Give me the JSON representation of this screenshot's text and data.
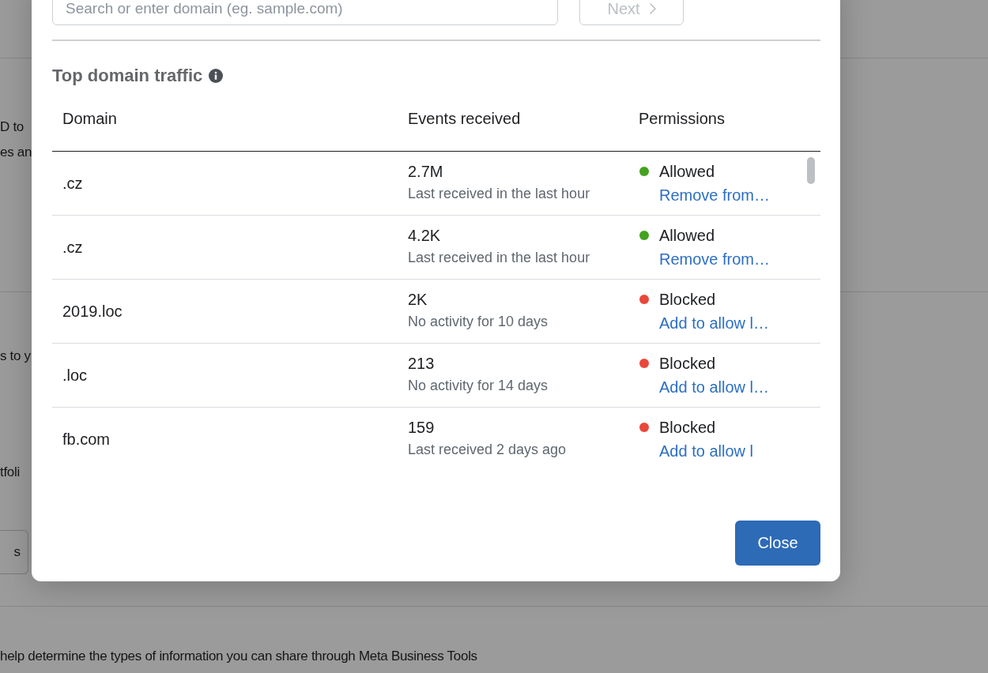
{
  "background_page": {
    "intro_lines": [
      "D to",
      "es an"
    ],
    "settings_lines": [
      "s to y",
      "tfoli"
    ],
    "settings_button": "s",
    "footer_text": "help determine the types of information you can share through Meta Business Tools"
  },
  "dialog": {
    "search": {
      "placeholder": "Search or enter domain (eg. sample.com)"
    },
    "next_button": {
      "label": "Next",
      "disabled": true
    },
    "section_title": "Top domain traffic",
    "table": {
      "columns": [
        "Domain",
        "Events received",
        "Permissions"
      ],
      "rows": [
        {
          "domain": ".cz",
          "events": "2.7M",
          "last_activity": "Last received in the last hour",
          "permission": {
            "status": "Allowed",
            "color": "#45a21d",
            "action": "Remove from…"
          }
        },
        {
          "domain": ".cz",
          "events": "4.2K",
          "last_activity": "Last received in the last hour",
          "permission": {
            "status": "Allowed",
            "color": "#45a21d",
            "action": "Remove from…"
          }
        },
        {
          "domain": "2019.loc",
          "events": "2K",
          "last_activity": "No activity for 10 days",
          "permission": {
            "status": "Blocked",
            "color": "#e9473b",
            "action": "Add to allow l…"
          }
        },
        {
          "domain": ".loc",
          "events": "213",
          "last_activity": "No activity for 14 days",
          "permission": {
            "status": "Blocked",
            "color": "#e9473b",
            "action": "Add to allow l…"
          }
        },
        {
          "domain": "fb.com",
          "events": "159",
          "last_activity": "Last received 2 days ago",
          "permission": {
            "status": "Blocked",
            "color": "#e9473b",
            "action": "Add to allow l"
          }
        }
      ]
    },
    "close_button": "Close"
  }
}
